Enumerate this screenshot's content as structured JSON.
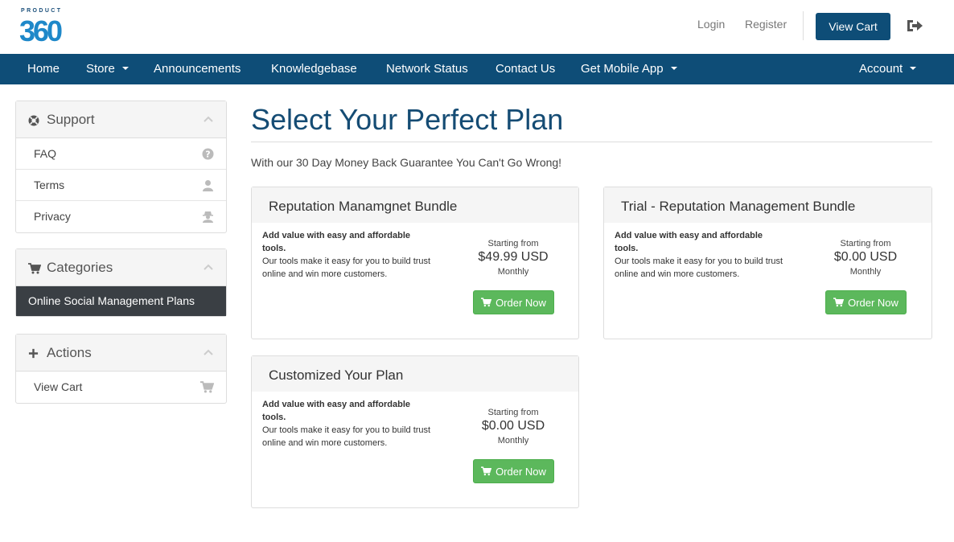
{
  "header": {
    "brand_top": "PRODUCT",
    "brand_number": "360",
    "login": "Login",
    "register": "Register",
    "view_cart": "View Cart"
  },
  "nav": {
    "items": [
      {
        "label": "Home"
      },
      {
        "label": "Store"
      },
      {
        "label": "Announcements"
      },
      {
        "label": "Knowledgebase"
      },
      {
        "label": "Network Status"
      },
      {
        "label": "Contact Us"
      },
      {
        "label": "Get Mobile App"
      }
    ],
    "account": "Account"
  },
  "sidebar": {
    "support": {
      "title": "Support",
      "items": [
        {
          "label": "FAQ",
          "icon": "question-circle-icon"
        },
        {
          "label": "Terms",
          "icon": "user-icon"
        },
        {
          "label": "Privacy",
          "icon": "user-secret-icon"
        }
      ]
    },
    "categories": {
      "title": "Categories",
      "items": [
        {
          "label": "Online Social Management Plans",
          "active": true
        }
      ]
    },
    "actions": {
      "title": "Actions",
      "items": [
        {
          "label": "View Cart",
          "icon": "cart-icon"
        }
      ]
    }
  },
  "main": {
    "title": "Select Your Perfect Plan",
    "subtitle": "With our 30 Day Money Back Guarantee You Can't Go Wrong!",
    "products": [
      {
        "name": "Reputation Manamgnet Bundle",
        "tagline": "Add value with easy and affordable tools.",
        "description": "Our tools make it easy for you to build trust online and win more customers.",
        "starting_from": "Starting from",
        "price": "$49.99 USD",
        "cycle": "Monthly",
        "order_label": "Order Now"
      },
      {
        "name": "Trial - Reputation Management Bundle",
        "tagline": "Add value with easy and affordable tools.",
        "description": "Our tools make it easy for you to build trust online and win more customers.",
        "starting_from": "Starting from",
        "price": "$0.00 USD",
        "cycle": "Monthly",
        "order_label": "Order Now"
      },
      {
        "name": "Customized Your Plan",
        "tagline": "Add value with easy and affordable tools.",
        "description": "Our tools make it easy for you to build trust online and win more customers.",
        "starting_from": "Starting from",
        "price": "$0.00 USD",
        "cycle": "Monthly",
        "order_label": "Order Now"
      }
    ]
  },
  "colors": {
    "brand_blue": "#0e4d77",
    "title_blue": "#154c74",
    "order_green": "#5cb85c",
    "active_dark": "#3a3f44"
  }
}
